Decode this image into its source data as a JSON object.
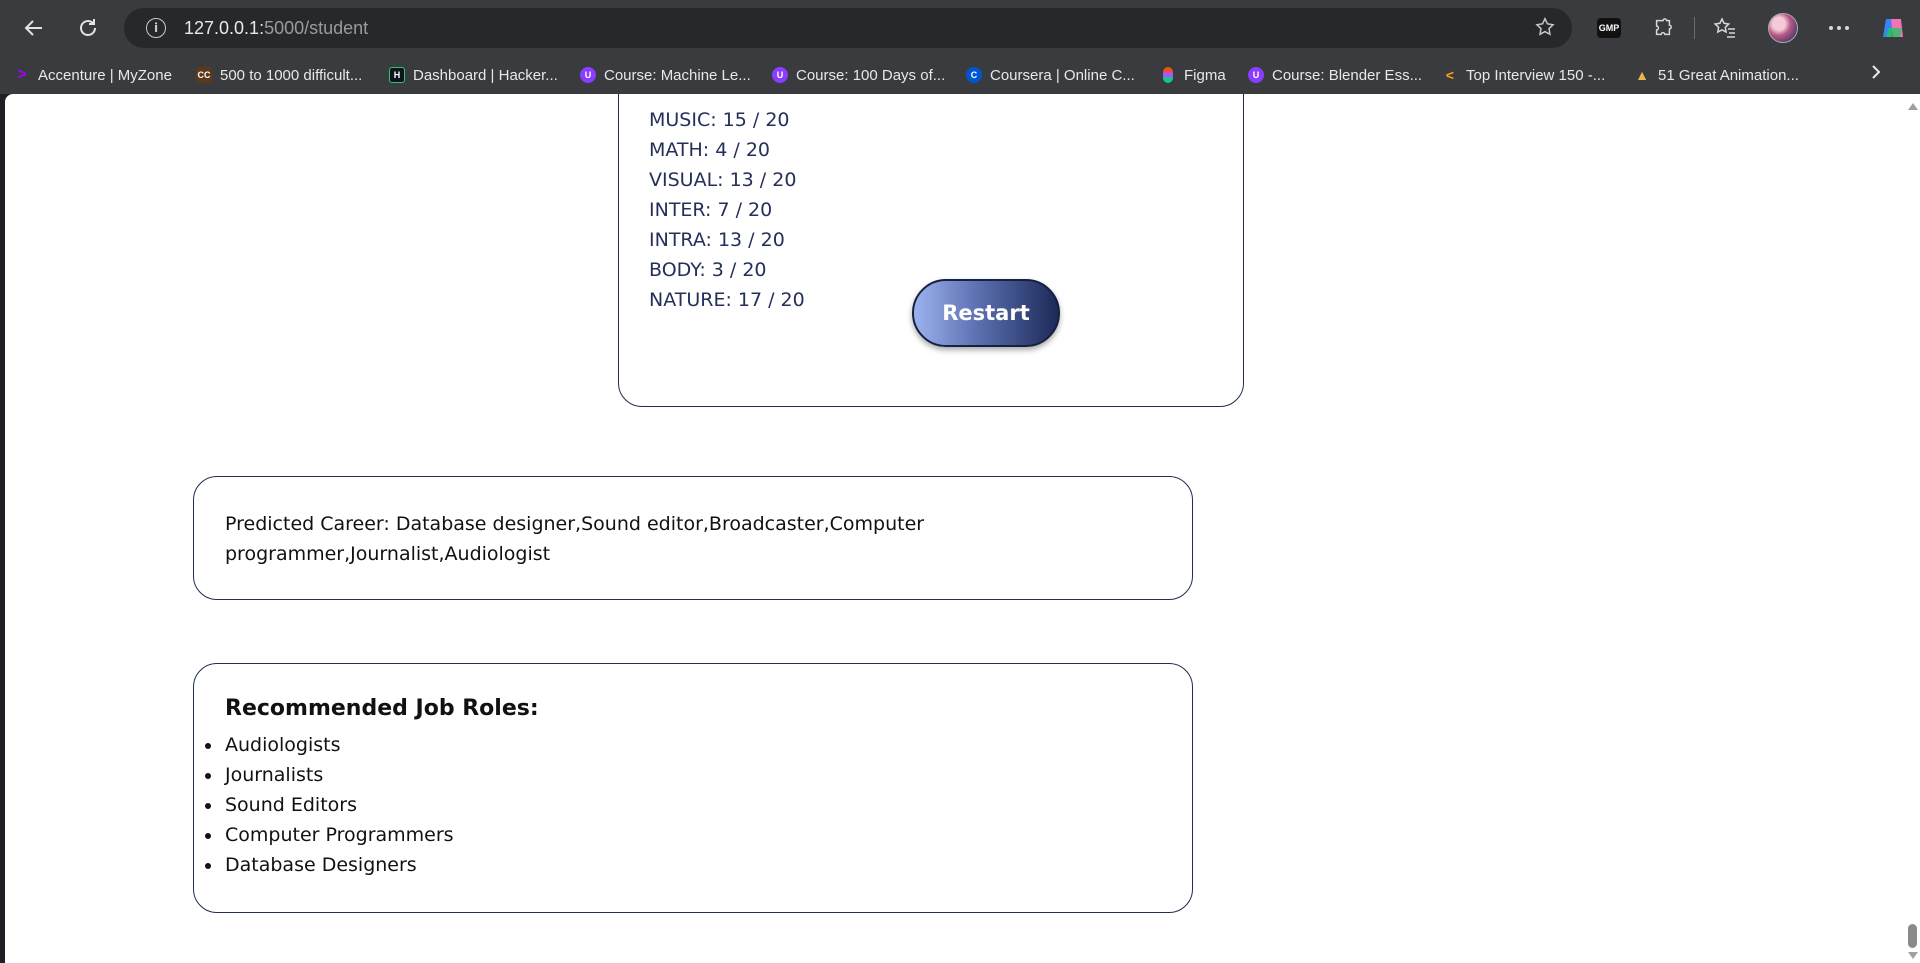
{
  "browser": {
    "url_host": "127.0.0.1:",
    "url_path": "5000/student",
    "bookmarks": [
      {
        "label": "Accenture | MyZone",
        "icon": "accenture-icon",
        "color": "#a100ff"
      },
      {
        "label": "500 to 1000 difficult...",
        "icon": "cc-icon",
        "color": "#5a3a1a"
      },
      {
        "label": "Dashboard | Hacker...",
        "icon": "hackerrank-icon",
        "color": "#0e141e"
      },
      {
        "label": "Course: Machine Le...",
        "icon": "course-icon",
        "color": "#8b3dff"
      },
      {
        "label": "Course: 100 Days of...",
        "icon": "course-icon",
        "color": "#8b3dff"
      },
      {
        "label": "Coursera | Online C...",
        "icon": "coursera-icon",
        "color": "#0056d2"
      },
      {
        "label": "Figma",
        "icon": "figma-icon",
        "color": "#f24e1e"
      },
      {
        "label": "Course: Blender Ess...",
        "icon": "course-icon",
        "color": "#8b3dff"
      },
      {
        "label": "Top Interview 150 -...",
        "icon": "leetcode-icon",
        "color": "#ffa116"
      },
      {
        "label": "51 Great Animation...",
        "icon": "island-icon",
        "color": "#e8b84a"
      }
    ]
  },
  "scores": [
    {
      "label": "MUSIC: 15 / 20"
    },
    {
      "label": "MATH: 4 / 20"
    },
    {
      "label": "VISUAL: 13 / 20"
    },
    {
      "label": "INTER: 7 / 20"
    },
    {
      "label": "INTRA: 13 / 20"
    },
    {
      "label": "BODY: 3 / 20"
    },
    {
      "label": "NATURE: 17 / 20"
    }
  ],
  "restart_label": "Restart",
  "career": {
    "text": "Predicted Career: Database designer,Sound editor,Broadcaster,Computer programmer,Journalist,Audiologist"
  },
  "roles": {
    "title": "Recommended Job Roles:",
    "items": [
      "Audiologists",
      "Journalists",
      "Sound Editors",
      "Computer Programmers",
      "Database Designers"
    ]
  }
}
